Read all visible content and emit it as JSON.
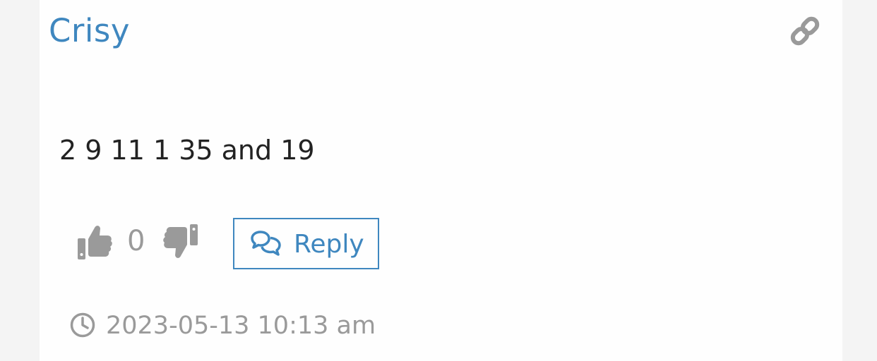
{
  "comment": {
    "author": "Crisy",
    "text": "2 9 11 1 35 and 19",
    "votes": {
      "count": "0"
    },
    "reply_label": "Reply",
    "timestamp": "2023-05-13 10:13 am"
  },
  "icons": {
    "permalink": "link-icon",
    "upvote": "thumbs-up-icon",
    "downvote": "thumbs-down-icon",
    "reply": "comments-icon",
    "time": "clock-icon"
  },
  "colors": {
    "accent": "#3f87bf",
    "muted": "#9a9a9a",
    "text": "#222222",
    "background": "#f4f4f4",
    "card": "#fefefe"
  }
}
